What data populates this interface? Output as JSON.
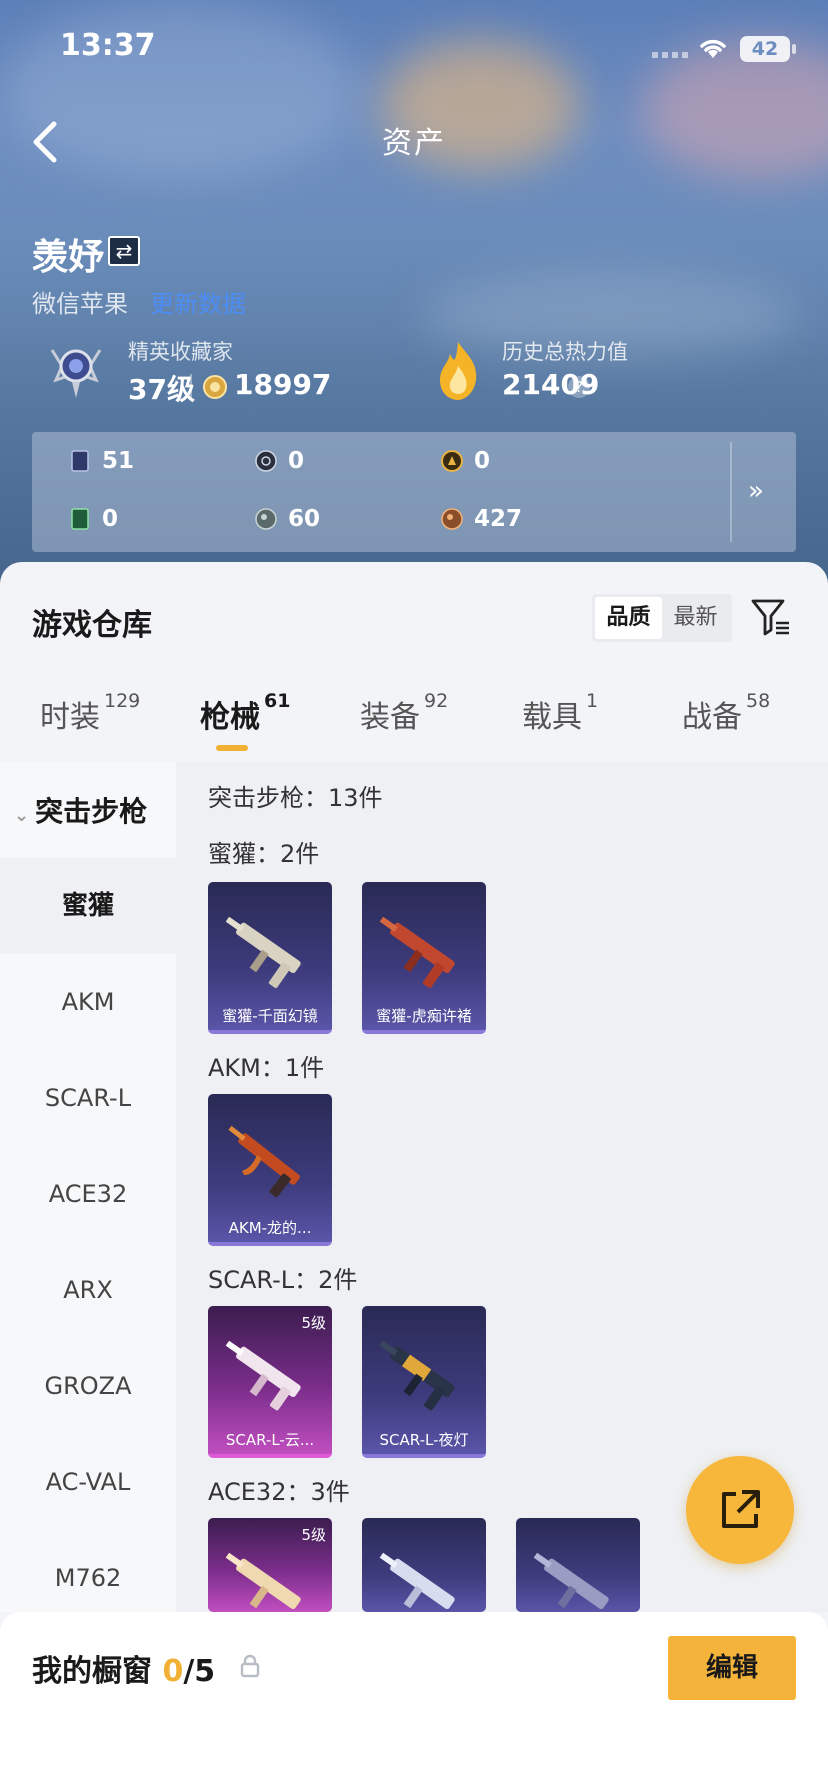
{
  "status": {
    "time": "13:37",
    "battery": "42"
  },
  "nav": {
    "title": "资产"
  },
  "profile": {
    "name": "羡妤",
    "platform": "微信苹果",
    "platform_link": "更新数据",
    "rank_title": "精英收藏家",
    "level": "37级",
    "coins": "18997",
    "heat_label": "历史总热力值",
    "heat_value": "21409"
  },
  "stats": [
    {
      "icon": "card-icon",
      "value": "51"
    },
    {
      "icon": "compass-icon",
      "value": "0"
    },
    {
      "icon": "gold-badge-icon",
      "value": "0"
    },
    {
      "icon": "green-card-icon",
      "value": "0"
    },
    {
      "icon": "grey-orb-icon",
      "value": "60"
    },
    {
      "icon": "bronze-orb-icon",
      "value": "427"
    }
  ],
  "warehouse": {
    "title": "游戏仓库",
    "sort": [
      "品质",
      "最新"
    ]
  },
  "tabs": [
    {
      "label": "时装",
      "count": "129"
    },
    {
      "label": "枪械",
      "count": "61"
    },
    {
      "label": "装备",
      "count": "92"
    },
    {
      "label": "载具",
      "count": "1"
    },
    {
      "label": "战备",
      "count": "58"
    }
  ],
  "sidebar": {
    "category": "突击步枪",
    "items": [
      "蜜獾",
      "AKM",
      "SCAR-L",
      "ACE32",
      "ARX",
      "GROZA",
      "AC-VAL",
      "M762"
    ]
  },
  "content": {
    "summary": "突击步枪：13件",
    "groups": [
      {
        "title": "蜜獾：2件",
        "items": [
          {
            "name": "蜜獾-千面幻镜",
            "level": "",
            "style": "purple"
          },
          {
            "name": "蜜獾-虎痴许褚",
            "level": "",
            "style": "purple"
          }
        ]
      },
      {
        "title": "AKM：1件",
        "items": [
          {
            "name": "AKM-龙的...",
            "level": "",
            "style": "purple"
          }
        ]
      },
      {
        "title": "SCAR-L：2件",
        "items": [
          {
            "name": "SCAR-L-云...",
            "level": "5级",
            "style": "pink"
          },
          {
            "name": "SCAR-L-夜灯",
            "level": "",
            "style": "purple"
          }
        ]
      },
      {
        "title": "ACE32：3件",
        "items": [
          {
            "name": "",
            "level": "5级",
            "style": "pink"
          },
          {
            "name": "",
            "level": "",
            "style": "purple"
          },
          {
            "name": "",
            "level": "",
            "style": "purple"
          }
        ]
      }
    ]
  },
  "vitrine": {
    "title": "我的橱窗",
    "count": "0",
    "total": "/5",
    "edit": "编辑"
  },
  "colors": {
    "accent": "#f4b33a",
    "link": "#4c8ef5",
    "card_purple": "#3d3b7c",
    "card_pink": "#c04ec0"
  }
}
